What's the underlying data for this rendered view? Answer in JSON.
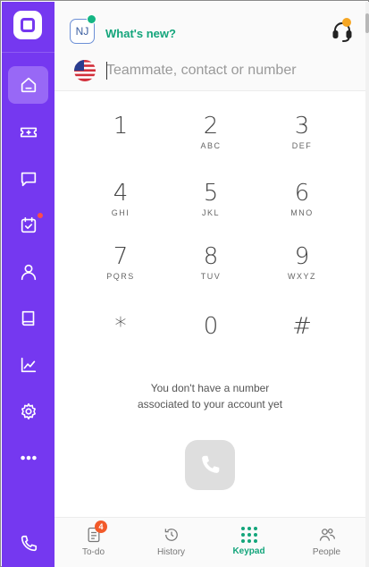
{
  "header": {
    "avatar_initials": "NJ",
    "whats_new": "What's new?",
    "search_placeholder": "Teammate, contact or number"
  },
  "sidebar": {
    "items": [
      {
        "icon": "home-icon",
        "active": true
      },
      {
        "icon": "ticket-icon"
      },
      {
        "icon": "chat-icon"
      },
      {
        "icon": "calendar-check-icon",
        "badge_dot": true
      },
      {
        "icon": "user-icon"
      },
      {
        "icon": "book-icon"
      },
      {
        "icon": "analytics-icon"
      },
      {
        "icon": "settings-icon"
      },
      {
        "icon": "more-icon"
      },
      {
        "icon": "phone-icon"
      }
    ]
  },
  "keypad": {
    "keys": [
      {
        "digit": "1",
        "letters": ""
      },
      {
        "digit": "2",
        "letters": "ABC"
      },
      {
        "digit": "3",
        "letters": "DEF"
      },
      {
        "digit": "4",
        "letters": "GHI"
      },
      {
        "digit": "5",
        "letters": "JKL"
      },
      {
        "digit": "6",
        "letters": "MNO"
      },
      {
        "digit": "7",
        "letters": "PQRS"
      },
      {
        "digit": "8",
        "letters": "TUV"
      },
      {
        "digit": "9",
        "letters": "WXYZ"
      },
      {
        "digit": "*",
        "letters": ""
      },
      {
        "digit": "0",
        "letters": ""
      },
      {
        "digit": "#",
        "letters": ""
      }
    ]
  },
  "notice": {
    "line1": "You don't have a number",
    "line2": "associated to your account yet"
  },
  "bottom_nav": {
    "items": [
      {
        "label": "To-do",
        "badge": "4"
      },
      {
        "label": "History"
      },
      {
        "label": "Keypad",
        "active": true
      },
      {
        "label": "People"
      }
    ]
  },
  "colors": {
    "sidebar": "#7538f0",
    "accent_green": "#13a57b",
    "badge_red": "#ff4b4b",
    "headset_badge": "#f5a623"
  }
}
